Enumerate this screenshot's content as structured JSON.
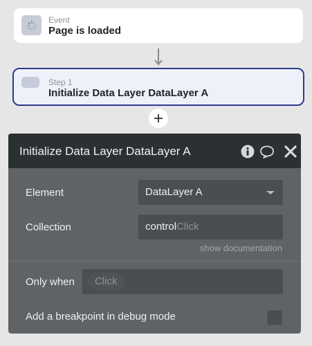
{
  "event": {
    "label": "Event",
    "title": "Page is loaded",
    "icon": "loading-spinner-icon"
  },
  "step": {
    "label": "Step 1",
    "title": "Initialize Data Layer DataLayer A"
  },
  "add_button": {
    "symbol": "+"
  },
  "panel": {
    "title": "Initialize Data Layer DataLayer A",
    "icons": [
      "info-icon",
      "comment-icon",
      "close-icon"
    ],
    "element": {
      "label": "Element",
      "value": "DataLayer A"
    },
    "collection": {
      "label": "Collection",
      "value": "control",
      "placeholder": "Click"
    },
    "show_documentation": "show documentation",
    "only_when": {
      "label": "Only when",
      "placeholder": "Click"
    },
    "breakpoint": {
      "label": "Add a breakpoint in debug mode",
      "checked": false
    }
  },
  "colors": {
    "background": "#e6e6e6",
    "step_border": "#2d3a8c",
    "panel_bg": "#5f6366",
    "panel_header": "#2b3033"
  }
}
